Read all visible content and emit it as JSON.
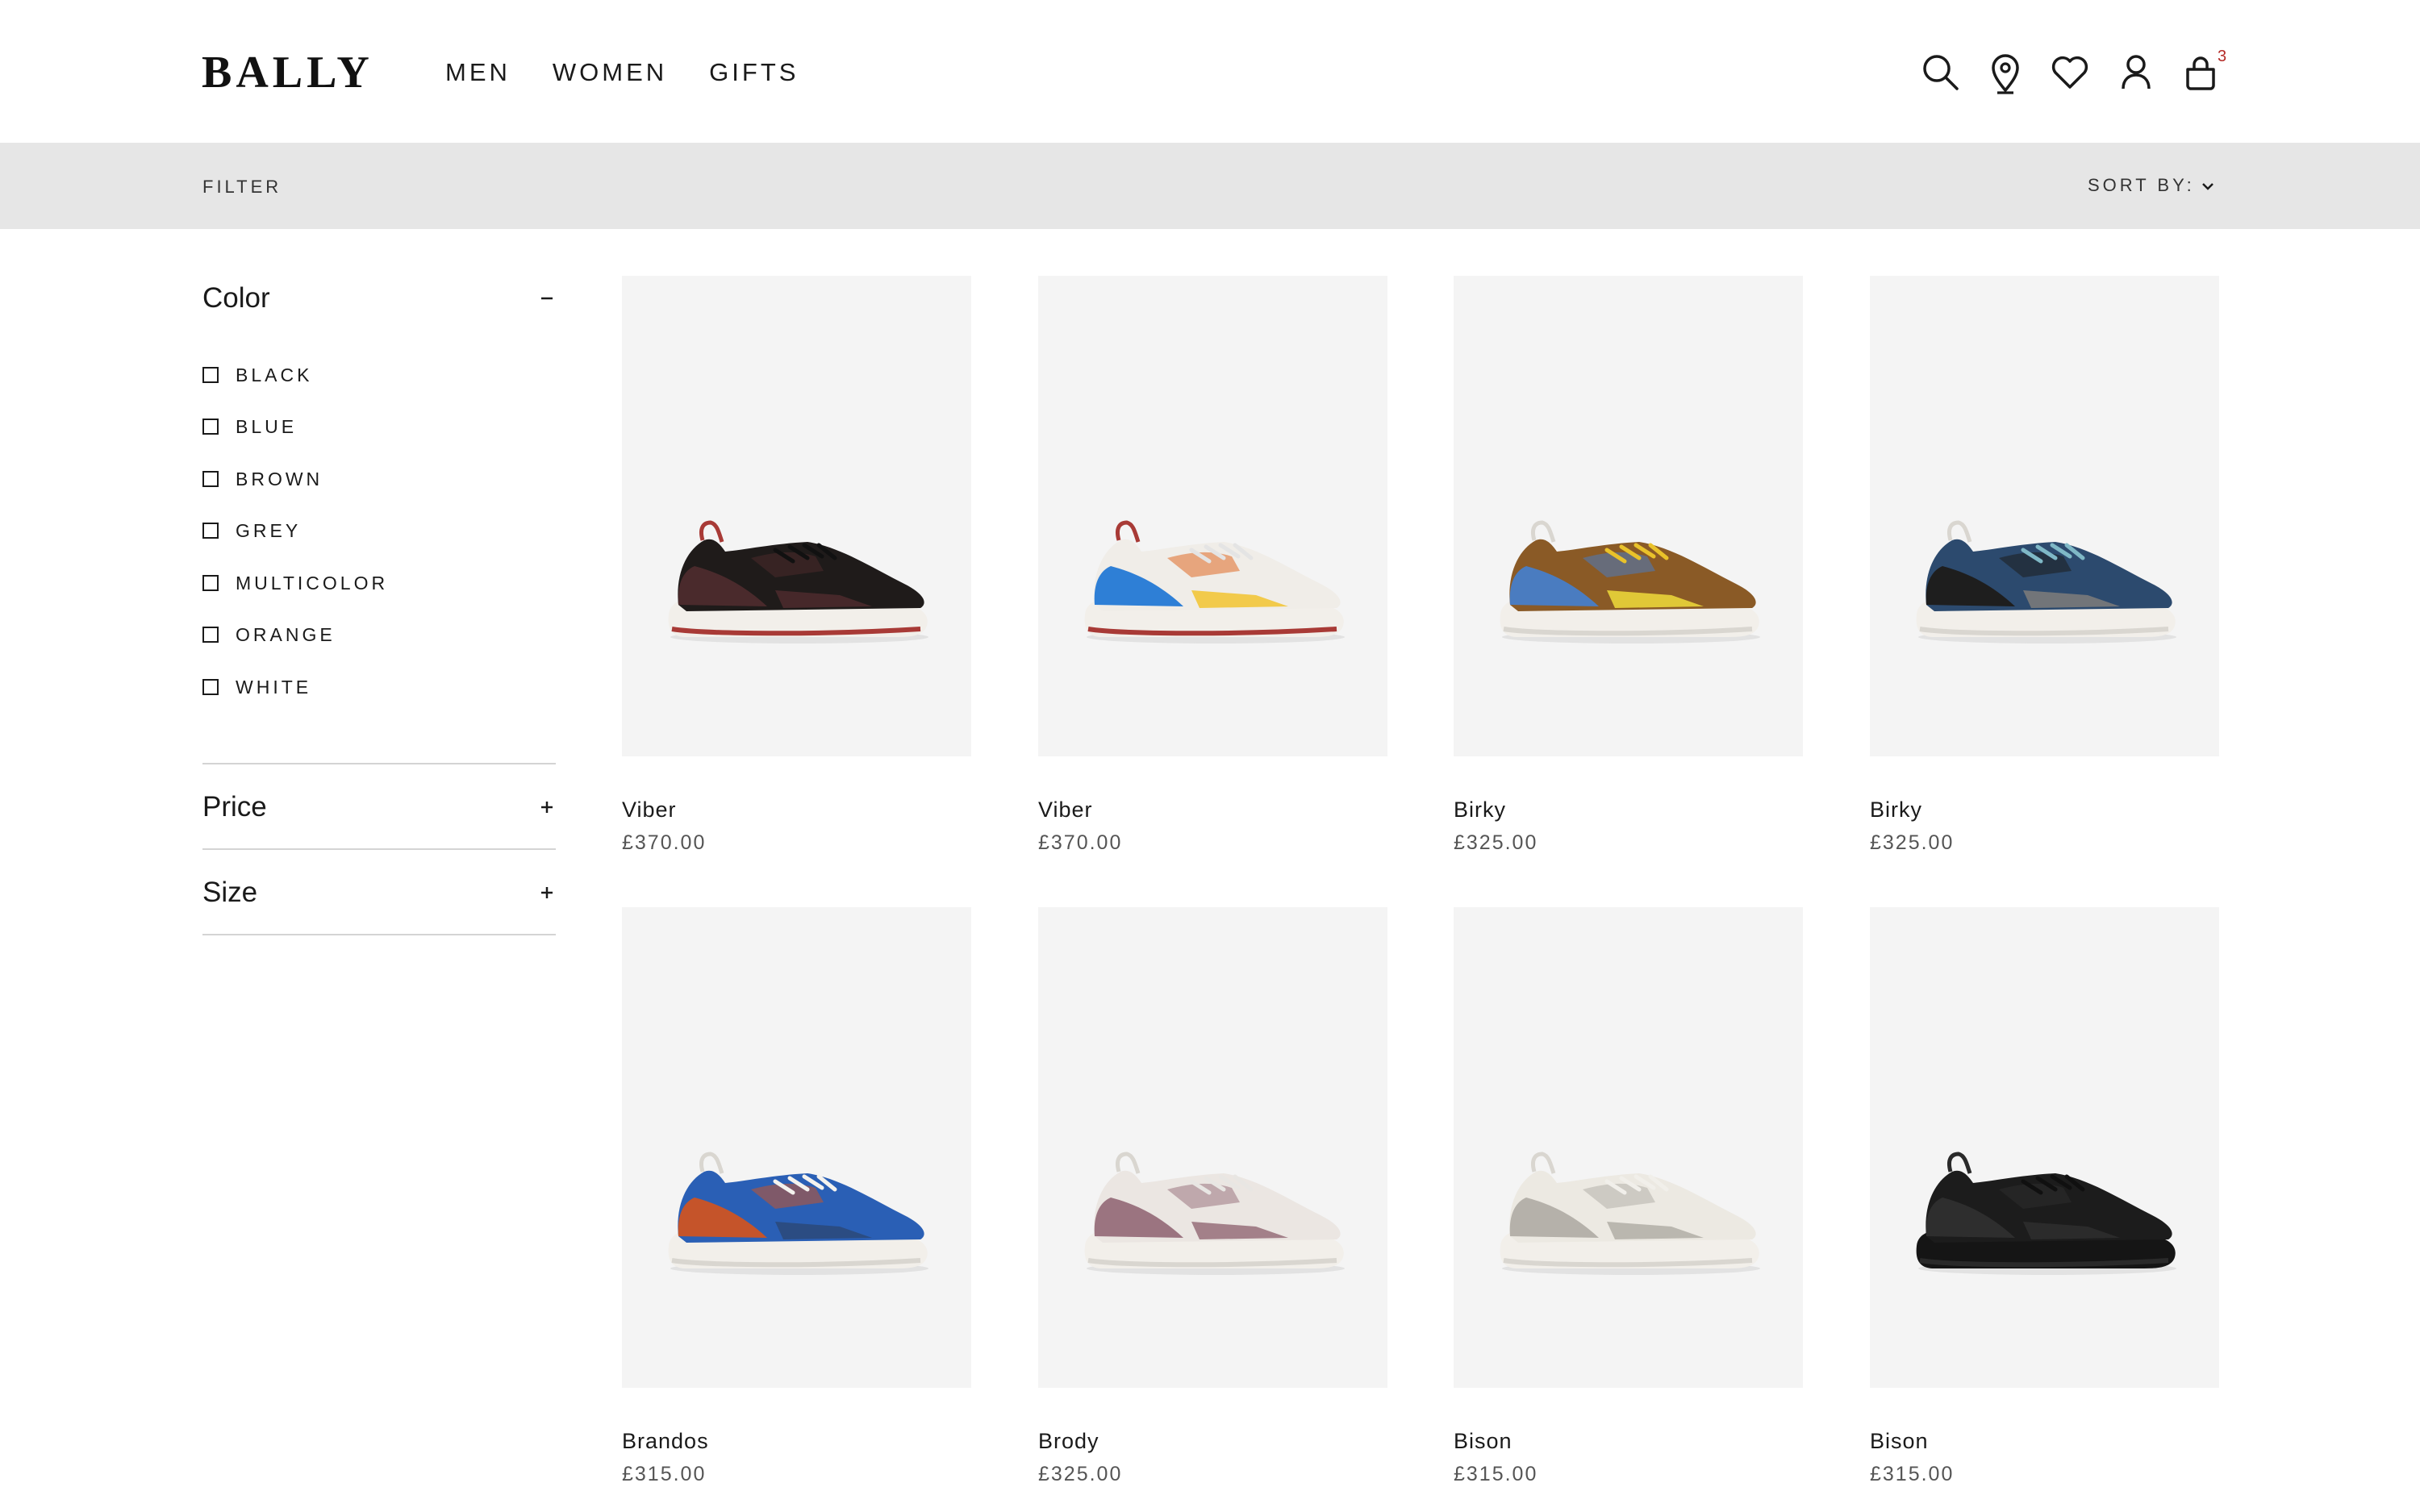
{
  "brand": {
    "logo": "BALLY"
  },
  "nav": {
    "items": [
      "MEN",
      "WOMEN",
      "GIFTS"
    ]
  },
  "header": {
    "cart_count": "3",
    "icons": [
      "search-icon",
      "store-locator-icon",
      "wishlist-icon",
      "account-icon",
      "cart-icon"
    ]
  },
  "filter_bar": {
    "filter_label": "FILTER",
    "sort_label": "SORT BY:"
  },
  "filters": {
    "color": {
      "title": "Color",
      "toggle": "−",
      "options": [
        "BLACK",
        "BLUE",
        "BROWN",
        "GREY",
        "MULTICOLOR",
        "ORANGE",
        "WHITE"
      ]
    },
    "price": {
      "title": "Price",
      "toggle": "+"
    },
    "size": {
      "title": "Size",
      "toggle": "+"
    }
  },
  "products": [
    {
      "name": "Viber",
      "price": "£370.00",
      "colors": {
        "upper": "#1f1b1a",
        "accent": "#4a2a2c",
        "sole": "#f2efea",
        "sole_stripe": "#a83a36",
        "lace": "#111111"
      }
    },
    {
      "name": "Viber",
      "price": "£370.00",
      "colors": {
        "upper": "#f0ede8",
        "accent": "#2e7fd6",
        "sole": "#f2efea",
        "sole_stripe": "#a83a36",
        "lace": "#e4e4e4",
        "extra": "#f2c53a",
        "extra2": "#e06a24"
      }
    },
    {
      "name": "Birky",
      "price": "£325.00",
      "colors": {
        "upper": "#8a5a26",
        "accent": "#4a7cc0",
        "sole": "#f2efea",
        "sole_stripe": "#d9d6d0",
        "lace": "#e9c22a",
        "extra": "#e9d43a"
      }
    },
    {
      "name": "Birky",
      "price": "£325.00",
      "colors": {
        "upper": "#2c4a6e",
        "accent": "#1e1e1e",
        "sole": "#f2efea",
        "sole_stripe": "#d9d6d0",
        "lace": "#7fb8c6",
        "extra": "#7a7a7a"
      }
    },
    {
      "name": "Brandos",
      "price": "£315.00",
      "colors": {
        "upper": "#2a5fb5",
        "accent": "#c5542a",
        "sole": "#f2efea",
        "sole_stripe": "#d9d6d0",
        "lace": "#f4f2ee",
        "extra": "#2b4a7c"
      }
    },
    {
      "name": "Brody",
      "price": "£325.00",
      "colors": {
        "upper": "#ebe6e2",
        "accent": "#9b7480",
        "sole": "#f2efea",
        "sole_stripe": "#d9d6d0",
        "lace": "#e8e6e3"
      }
    },
    {
      "name": "Bison",
      "price": "£315.00",
      "colors": {
        "upper": "#ece9e2",
        "accent": "#b5b1aa",
        "sole": "#f2efea",
        "sole_stripe": "#d9d6d0",
        "lace": "#f1efea"
      }
    },
    {
      "name": "Bison",
      "price": "£315.00",
      "colors": {
        "upper": "#1c1c1c",
        "accent": "#2e2e2e",
        "sole": "#151515",
        "sole_stripe": "#2a2a2a",
        "lace": "#101010"
      }
    }
  ]
}
